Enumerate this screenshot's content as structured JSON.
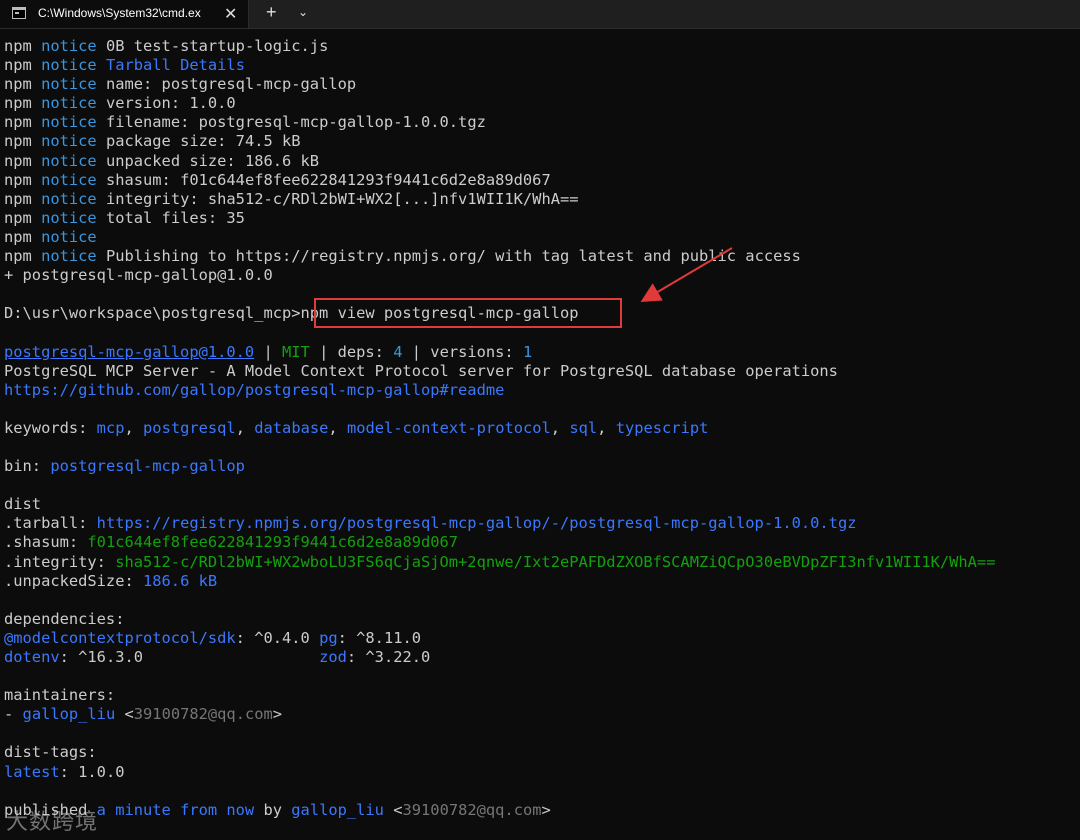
{
  "window": {
    "tab_title": "C:\\Windows\\System32\\cmd.ex",
    "close_glyph": "✕",
    "new_tab_glyph": "+",
    "dropdown_glyph": "⌄"
  },
  "terminal": {
    "lines": [
      [
        {
          "t": "npm ",
          "c": "white"
        },
        {
          "t": "notice",
          "c": "cyan"
        },
        {
          "t": " 0B test-startup-logic.js",
          "c": "white"
        }
      ],
      [
        {
          "t": "npm ",
          "c": "white"
        },
        {
          "t": "notice",
          "c": "cyan"
        },
        {
          "t": " ",
          "c": "white"
        },
        {
          "t": "Tarball Details",
          "c": "blue"
        }
      ],
      [
        {
          "t": "npm ",
          "c": "white"
        },
        {
          "t": "notice",
          "c": "cyan"
        },
        {
          "t": " name: postgresql-mcp-gallop",
          "c": "white"
        }
      ],
      [
        {
          "t": "npm ",
          "c": "white"
        },
        {
          "t": "notice",
          "c": "cyan"
        },
        {
          "t": " version: 1.0.0",
          "c": "white"
        }
      ],
      [
        {
          "t": "npm ",
          "c": "white"
        },
        {
          "t": "notice",
          "c": "cyan"
        },
        {
          "t": " filename: postgresql-mcp-gallop-1.0.0.tgz",
          "c": "white"
        }
      ],
      [
        {
          "t": "npm ",
          "c": "white"
        },
        {
          "t": "notice",
          "c": "cyan"
        },
        {
          "t": " package size: 74.5 kB",
          "c": "white"
        }
      ],
      [
        {
          "t": "npm ",
          "c": "white"
        },
        {
          "t": "notice",
          "c": "cyan"
        },
        {
          "t": " unpacked size: 186.6 kB",
          "c": "white"
        }
      ],
      [
        {
          "t": "npm ",
          "c": "white"
        },
        {
          "t": "notice",
          "c": "cyan"
        },
        {
          "t": " shasum: f01c644ef8fee622841293f9441c6d2e8a89d067",
          "c": "white"
        }
      ],
      [
        {
          "t": "npm ",
          "c": "white"
        },
        {
          "t": "notice",
          "c": "cyan"
        },
        {
          "t": " integrity: sha512-c/RDl2bWI+WX2[...]nfv1WII1K/WhA==",
          "c": "white"
        }
      ],
      [
        {
          "t": "npm ",
          "c": "white"
        },
        {
          "t": "notice",
          "c": "cyan"
        },
        {
          "t": " total files: 35",
          "c": "white"
        }
      ],
      [
        {
          "t": "npm ",
          "c": "white"
        },
        {
          "t": "notice",
          "c": "cyan"
        }
      ],
      [
        {
          "t": "npm ",
          "c": "white"
        },
        {
          "t": "notice",
          "c": "cyan"
        },
        {
          "t": " Publishing to https://registry.npmjs.org/ with tag latest and public access",
          "c": "white"
        }
      ],
      [
        {
          "t": "+ postgresql-mcp-gallop@1.0.0",
          "c": "white"
        }
      ],
      [],
      [
        {
          "t": "D:\\usr\\workspace\\postgresql_mcp>npm view postgresql-mcp-gallop",
          "c": "white"
        }
      ],
      [],
      [
        {
          "t": "postgresql-mcp-gallop@1.0.0",
          "c": "blue",
          "u": true
        },
        {
          "t": " | ",
          "c": "white"
        },
        {
          "t": "MIT",
          "c": "green"
        },
        {
          "t": " | deps: ",
          "c": "white"
        },
        {
          "t": "4",
          "c": "cyan"
        },
        {
          "t": " | versions: ",
          "c": "white"
        },
        {
          "t": "1",
          "c": "cyan"
        }
      ],
      [
        {
          "t": "PostgreSQL MCP Server - A Model Context Protocol server for PostgreSQL database operations",
          "c": "white"
        }
      ],
      [
        {
          "t": "https://github.com/gallop/postgresql-mcp-gallop#readme",
          "c": "blue"
        }
      ],
      [],
      [
        {
          "t": "keywords: ",
          "c": "white"
        },
        {
          "t": "mcp",
          "c": "blue"
        },
        {
          "t": ", ",
          "c": "white"
        },
        {
          "t": "postgresql",
          "c": "blue"
        },
        {
          "t": ", ",
          "c": "white"
        },
        {
          "t": "database",
          "c": "blue"
        },
        {
          "t": ", ",
          "c": "white"
        },
        {
          "t": "model-context-protocol",
          "c": "blue"
        },
        {
          "t": ", ",
          "c": "white"
        },
        {
          "t": "sql",
          "c": "blue"
        },
        {
          "t": ", ",
          "c": "white"
        },
        {
          "t": "typescript",
          "c": "blue"
        }
      ],
      [],
      [
        {
          "t": "bin: ",
          "c": "white"
        },
        {
          "t": "postgresql-mcp-gallop",
          "c": "blue"
        }
      ],
      [],
      [
        {
          "t": "dist",
          "c": "white"
        }
      ],
      [
        {
          "t": ".tarball: ",
          "c": "white"
        },
        {
          "t": "https://registry.npmjs.org/postgresql-mcp-gallop/-/postgresql-mcp-gallop-1.0.0.tgz",
          "c": "blue"
        }
      ],
      [
        {
          "t": ".shasum: ",
          "c": "white"
        },
        {
          "t": "f01c644ef8fee622841293f9441c6d2e8a89d067",
          "c": "green"
        }
      ],
      [
        {
          "t": ".integrity: ",
          "c": "white"
        },
        {
          "t": "sha512-c/RDl2bWI+WX2wboLU3FS6qCjaSjOm+2qnwe/Ixt2ePAFDdZXOBfSCAMZiQCpO30eBVDpZFI3nfv1WII1K/WhA==",
          "c": "green"
        }
      ],
      [
        {
          "t": ".unpackedSize: ",
          "c": "white"
        },
        {
          "t": "186.6 kB",
          "c": "blue"
        }
      ],
      [],
      [
        {
          "t": "dependencies:",
          "c": "white"
        }
      ],
      [
        {
          "t": "@modelcontextprotocol/sdk",
          "c": "blue"
        },
        {
          "t": ": ^0.4.0 ",
          "c": "white"
        },
        {
          "t": "pg",
          "c": "blue"
        },
        {
          "t": ": ^8.11.0",
          "c": "white"
        }
      ],
      [
        {
          "t": "dotenv",
          "c": "blue"
        },
        {
          "t": ": ^16.3.0                   ",
          "c": "white"
        },
        {
          "t": "zod",
          "c": "blue"
        },
        {
          "t": ": ^3.22.0",
          "c": "white"
        }
      ],
      [],
      [
        {
          "t": "maintainers:",
          "c": "white"
        }
      ],
      [
        {
          "t": "- ",
          "c": "white"
        },
        {
          "t": "gallop_liu",
          "c": "blue"
        },
        {
          "t": " <",
          "c": "white"
        },
        {
          "t": "39100782@qq.com",
          "c": "gray"
        },
        {
          "t": ">",
          "c": "white"
        }
      ],
      [],
      [
        {
          "t": "dist-tags:",
          "c": "white"
        }
      ],
      [
        {
          "t": "latest",
          "c": "blue"
        },
        {
          "t": ": 1.0.0",
          "c": "white"
        }
      ],
      [],
      [
        {
          "t": "published ",
          "c": "white"
        },
        {
          "t": "a minute from now",
          "c": "blue"
        },
        {
          "t": " by ",
          "c": "white"
        },
        {
          "t": "gallop_liu",
          "c": "blue"
        },
        {
          "t": " <",
          "c": "white"
        },
        {
          "t": "39100782@qq.com",
          "c": "gray"
        },
        {
          "t": ">",
          "c": "white"
        }
      ]
    ]
  },
  "annotation": {
    "highlight_color": "#e03a3a",
    "watermark": "大数跨境"
  }
}
